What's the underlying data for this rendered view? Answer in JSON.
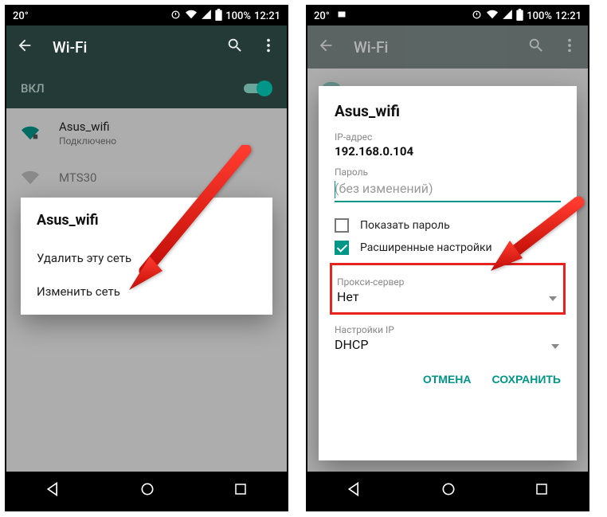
{
  "statusbar": {
    "temperature": "20°",
    "battery": "100%",
    "time": "12:21"
  },
  "appbar": {
    "title": "Wi-Fi"
  },
  "toggle": {
    "label": "ВКЛ"
  },
  "networks": [
    {
      "name": "Asus_wifi",
      "status": "Подключено"
    },
    {
      "name": "MTS30",
      "status": ""
    }
  ],
  "context_menu": {
    "title": "Asus_wifi",
    "items": [
      "Удалить эту сеть",
      "Изменить сеть"
    ]
  },
  "edit_dialog": {
    "title": "Asus_wifi",
    "ip_label": "IP-адрес",
    "ip_value": "192.168.0.104",
    "password_label": "Пароль",
    "password_placeholder": "(без изменений)",
    "show_password": "Показать пароль",
    "advanced": "Расширенные настройки",
    "proxy_label": "Прокси-сервер",
    "proxy_value": "Нет",
    "ip_settings_label": "Настройки IP",
    "ip_settings_value": "DHCP",
    "cancel": "ОТМЕНА",
    "save": "СОХРАНИТЬ"
  }
}
